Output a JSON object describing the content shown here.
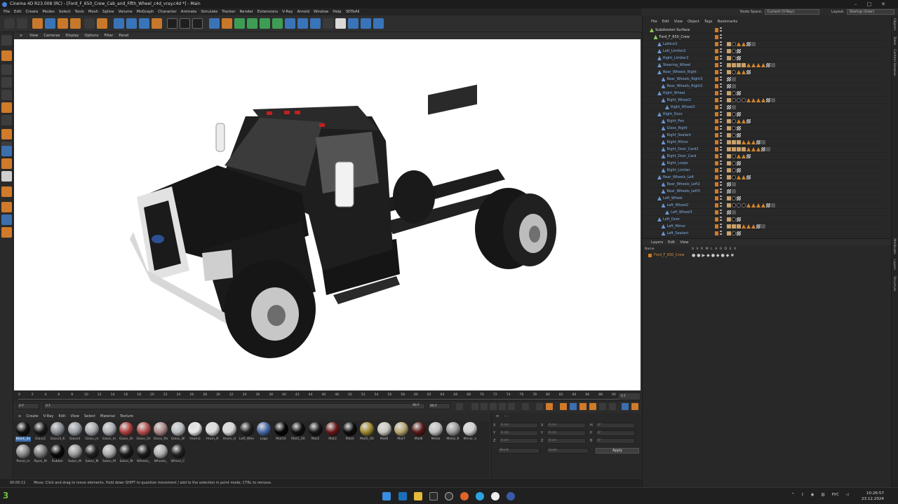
{
  "window": {
    "title": "Cinema 4D R23.008 (RC) - [Ford_F_650_Crew_Cab_and_Fifth_Wheel_c4d_vray.c4d *] - Main"
  },
  "menu": [
    "File",
    "Edit",
    "Create",
    "Modes",
    "Select",
    "Tools",
    "Mesh",
    "Spline",
    "Volume",
    "MoGraph",
    "Character",
    "Animate",
    "Simulate",
    "Tracker",
    "Render",
    "Extensions",
    "V-Ray",
    "Arnold",
    "Window",
    "Help",
    "3DToAll"
  ],
  "node_space": {
    "label": "Node Space:",
    "value": "Current (V-Ray)"
  },
  "layout": {
    "label": "Layout:",
    "value": "Startup (User)"
  },
  "viewport_menu": [
    "View",
    "Cameras",
    "Display",
    "Options",
    "Filter",
    "Panel"
  ],
  "timeline": {
    "ticks": [
      "0",
      "2",
      "4",
      "6",
      "8",
      "10",
      "12",
      "14",
      "16",
      "18",
      "20",
      "22",
      "24",
      "26",
      "28",
      "30",
      "32",
      "34",
      "36",
      "38",
      "40",
      "42",
      "44",
      "46",
      "48",
      "50",
      "52",
      "54",
      "56",
      "58",
      "60",
      "62",
      "64",
      "66",
      "68",
      "70",
      "72",
      "74",
      "76",
      "78",
      "80",
      "82",
      "84",
      "86",
      "88",
      "90"
    ],
    "current_frame": "0 F",
    "start": "0 F",
    "min": "0 F",
    "max": "90 F",
    "end": "90 F"
  },
  "material_menu": [
    "Create",
    "V-Ray",
    "Edit",
    "View",
    "Select",
    "Material",
    "Texture"
  ],
  "materials": [
    {
      "name": "Black_do",
      "color": "#111111"
    },
    {
      "name": "Glass2",
      "color": "#1a1a1a"
    },
    {
      "name": "Glass3_K",
      "color": "#8a8f95"
    },
    {
      "name": "Glass4",
      "color": "#9aa0a6"
    },
    {
      "name": "Glass_m",
      "color": "#a4a8ad"
    },
    {
      "name": "Glass_m",
      "color": "#a9adb2"
    },
    {
      "name": "Glass_Or",
      "color": "#b04040"
    },
    {
      "name": "Glass_Or",
      "color": "#b45050"
    },
    {
      "name": "Glass_Re",
      "color": "#a88"
    },
    {
      "name": "Glass_W",
      "color": "#b8bcc0"
    },
    {
      "name": "Hrom3",
      "color": "#e8e8e8"
    },
    {
      "name": "Hrom_R",
      "color": "#dcdcdc"
    },
    {
      "name": "Hrom_U",
      "color": "#d8d8d8"
    },
    {
      "name": "Left_Whe",
      "color": "#222"
    },
    {
      "name": "Logo",
      "color": "#4a6aa8"
    },
    {
      "name": "Mat10",
      "color": "#060606"
    },
    {
      "name": "Mat1_00",
      "color": "#101010"
    },
    {
      "name": "Mat2",
      "color": "#181818"
    },
    {
      "name": "Mat3",
      "color": "#6a1a1a"
    },
    {
      "name": "Mat4",
      "color": "#0c0c0c"
    },
    {
      "name": "Mat5_00",
      "color": "#a08a30"
    },
    {
      "name": "Mat6",
      "color": "#c8c8c0"
    },
    {
      "name": "Mat7",
      "color": "#b8a870"
    },
    {
      "name": "Mat8",
      "color": "#5a1a1a"
    },
    {
      "name": "Metal",
      "color": "#c0c0c0"
    },
    {
      "name": "Metal_R",
      "color": "#9a9a9a"
    },
    {
      "name": "Mirror_n",
      "color": "#cfcfcf"
    },
    {
      "name": "Panel_m",
      "color": "#8a8a8a"
    },
    {
      "name": "Pipes_M",
      "color": "#7a7a7a"
    },
    {
      "name": "Rubber",
      "color": "#0a0a0a"
    },
    {
      "name": "Salon_M",
      "color": "#9a9a9a"
    },
    {
      "name": "Salon_M",
      "color": "#222"
    },
    {
      "name": "Salon_M",
      "color": "#aaa"
    },
    {
      "name": "Salon_M",
      "color": "#1a1a1a"
    },
    {
      "name": "Wheels_",
      "color": "#1c1c1c"
    },
    {
      "name": "Wheels_",
      "color": "#b0b0b0"
    },
    {
      "name": "Wheel_C",
      "color": "#222"
    }
  ],
  "coords": {
    "rows": [
      [
        "X",
        "0 cm",
        "X",
        "0 cm",
        "H",
        "0 °"
      ],
      [
        "Y",
        "0 cm",
        "Y",
        "0 cm",
        "P",
        "0 °"
      ],
      [
        "Z",
        "0 cm",
        "Z",
        "0 cm",
        "B",
        "0 °"
      ]
    ],
    "mode1": "World",
    "mode2": "Scale",
    "apply": "Apply"
  },
  "status": {
    "time": "00:00:11",
    "text": "Move: Click and drag to move elements. Hold down SHIFT to quantize movement / add to the selection in point mode, CTRL to remove."
  },
  "objects_menu": [
    "File",
    "Edit",
    "View",
    "Object",
    "Tags",
    "Bookmarks"
  ],
  "objects": [
    {
      "name": "Subdivision Surface",
      "depth": 0,
      "root": true,
      "tags": []
    },
    {
      "name": "Ford_F_650_Crew",
      "depth": 1,
      "root": true,
      "tags": []
    },
    {
      "name": "Lattice3",
      "depth": 2,
      "tags": [
        "bone",
        "mat",
        "tri",
        "tri",
        "chk",
        "ph"
      ]
    },
    {
      "name": "Left_Limiter2",
      "depth": 2,
      "tags": [
        "bone",
        "mat",
        "chk"
      ]
    },
    {
      "name": "Right_Limiter2",
      "depth": 2,
      "tags": [
        "bone",
        "mat",
        "chk"
      ]
    },
    {
      "name": "Steering_Wheel",
      "depth": 2,
      "tags": [
        "bone",
        "bone",
        "bone",
        "bone",
        "tri",
        "tri",
        "tri",
        "tri",
        "chk",
        "ph"
      ]
    },
    {
      "name": "Rear_Wheels_Right",
      "depth": 2,
      "tags": [
        "bone",
        "mat",
        "tri",
        "tri",
        "chk"
      ]
    },
    {
      "name": "Rear_Wheels_Right3",
      "depth": 3,
      "tags": [
        "chk",
        "ph"
      ]
    },
    {
      "name": "Rear_Wheels_Right2",
      "depth": 3,
      "tags": [
        "chk",
        "ph"
      ]
    },
    {
      "name": "Right_Wheel",
      "depth": 2,
      "tags": [
        "bone",
        "mat",
        "chk"
      ]
    },
    {
      "name": "Right_Wheel2",
      "depth": 3,
      "tags": [
        "bone",
        "mat",
        "mat",
        "mat",
        "tri",
        "tri",
        "tri",
        "tri",
        "chk",
        "ph"
      ]
    },
    {
      "name": "Right_Wheel3",
      "depth": 4,
      "tags": [
        "chk",
        "ph"
      ]
    },
    {
      "name": "Right_Door",
      "depth": 2,
      "tags": [
        "bone",
        "mat",
        "chk"
      ]
    },
    {
      "name": "Right_Pen",
      "depth": 3,
      "tags": [
        "bone",
        "mat",
        "tri",
        "tri",
        "chk"
      ]
    },
    {
      "name": "Glass_Right",
      "depth": 3,
      "tags": [
        "bone",
        "mat",
        "chk"
      ]
    },
    {
      "name": "Right_Sealant",
      "depth": 3,
      "tags": [
        "bone",
        "mat",
        "chk"
      ]
    },
    {
      "name": "Right_Mirror",
      "depth": 3,
      "tags": [
        "bone",
        "bone",
        "bone",
        "tri",
        "tri",
        "tri",
        "chk",
        "ph"
      ]
    },
    {
      "name": "Right_Door_Card2",
      "depth": 3,
      "tags": [
        "bone",
        "bone",
        "bone",
        "bone",
        "tri",
        "tri",
        "tri",
        "chk",
        "ph"
      ]
    },
    {
      "name": "Right_Door_Card",
      "depth": 3,
      "tags": [
        "bone",
        "mat",
        "tri",
        "tri",
        "chk"
      ]
    },
    {
      "name": "Right_Loops",
      "depth": 3,
      "tags": [
        "bone",
        "mat",
        "chk"
      ]
    },
    {
      "name": "Right_Limiter",
      "depth": 3,
      "tags": [
        "bone",
        "mat",
        "chk"
      ]
    },
    {
      "name": "Rear_Wheels_Left",
      "depth": 2,
      "tags": [
        "bone",
        "mat",
        "tri",
        "tri",
        "chk"
      ]
    },
    {
      "name": "Rear_Wheels_Left2",
      "depth": 3,
      "tags": [
        "chk",
        "ph"
      ]
    },
    {
      "name": "Rear_Wheels_Left3",
      "depth": 3,
      "tags": [
        "chk",
        "ph"
      ]
    },
    {
      "name": "Left_Wheel",
      "depth": 2,
      "tags": [
        "bone",
        "mat",
        "chk"
      ]
    },
    {
      "name": "Left_Wheel2",
      "depth": 3,
      "tags": [
        "bone",
        "mat",
        "mat",
        "mat",
        "tri",
        "tri",
        "tri",
        "tri",
        "chk",
        "ph"
      ]
    },
    {
      "name": "Left_Wheel3",
      "depth": 4,
      "tags": [
        "chk",
        "ph"
      ]
    },
    {
      "name": "Left_Door",
      "depth": 2,
      "tags": [
        "bone",
        "mat",
        "chk"
      ]
    },
    {
      "name": "Left_Mirror",
      "depth": 3,
      "tags": [
        "bone",
        "bone",
        "bone",
        "tri",
        "tri",
        "tri",
        "chk",
        "ph"
      ]
    },
    {
      "name": "Left_Sealant",
      "depth": 3,
      "tags": [
        "bone",
        "mat",
        "chk"
      ]
    }
  ],
  "layers_menu": [
    "Layers",
    "Edit",
    "View"
  ],
  "layer_columns": {
    "name": "Name",
    "flags": "S V R M L A G D E X"
  },
  "layer_row": {
    "name": "Ford_F_650_Crew"
  },
  "right_tabs": [
    "Objects",
    "Takes",
    "Content Browser",
    "Attributes",
    "Layers",
    "Structure"
  ],
  "taskbar": {
    "app_badge": "3",
    "lang": "РУС",
    "time": "10:26:57",
    "date": "23.12.2024"
  },
  "colors": {
    "accent": "#3e6fad",
    "orange": "#d07a2a",
    "objtext": "#7fb0ea"
  }
}
